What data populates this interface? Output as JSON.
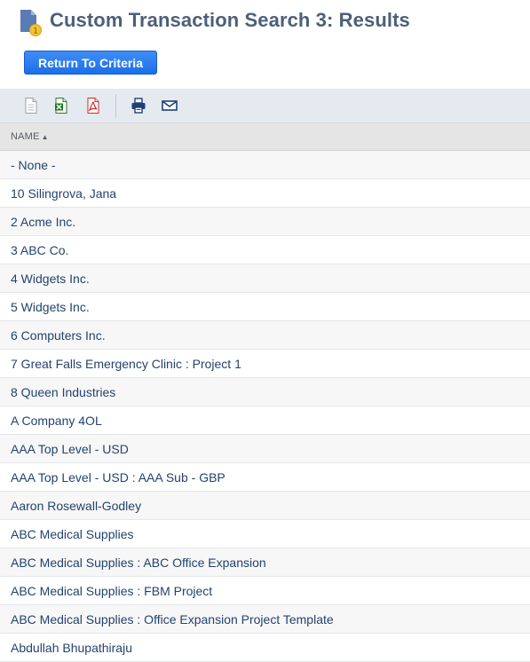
{
  "page": {
    "title": "Custom Transaction Search 3: Results",
    "return_button_label": "Return To Criteria",
    "accent_color": "#1c6fe8"
  },
  "toolbar": {
    "icons": [
      "export-csv-icon",
      "export-excel-icon",
      "export-pdf-icon",
      "print-icon",
      "email-icon"
    ]
  },
  "table": {
    "column_header": "NAME",
    "sort_direction": "ascending",
    "rows": [
      "- None -",
      "10 Silingrova, Jana",
      "2 Acme Inc.",
      "3 ABC Co.",
      "4 Widgets Inc.",
      "5 Widgets Inc.",
      "6 Computers Inc.",
      "7 Great Falls Emergency Clinic : Project 1",
      "8 Queen Industries",
      "A Company 4OL",
      "AAA Top Level - USD",
      "AAA Top Level - USD : AAA Sub - GBP",
      "Aaron Rosewall-Godley",
      "ABC Medical Supplies",
      "ABC Medical Supplies : ABC Office Expansion",
      "ABC Medical Supplies : FBM Project",
      "ABC Medical Supplies : Office Expansion Project Template",
      "Abdullah Bhupathiraju"
    ]
  }
}
